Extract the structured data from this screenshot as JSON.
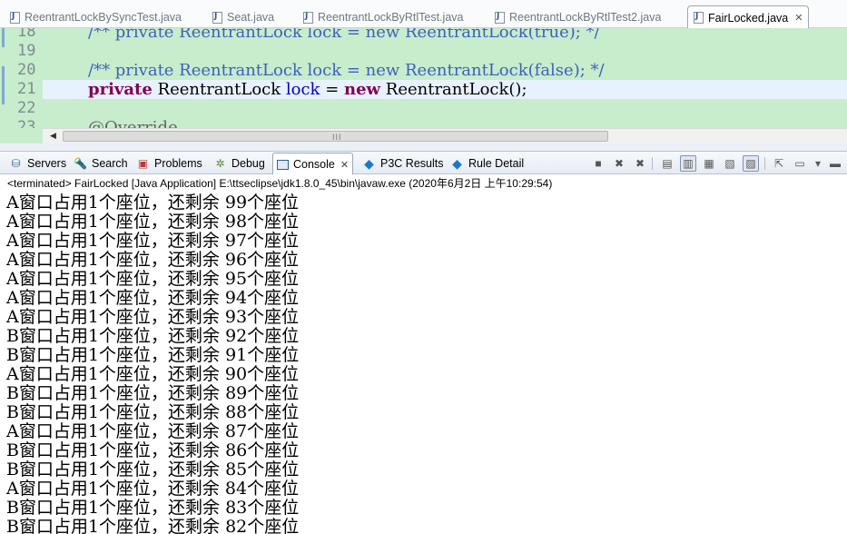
{
  "editor_tabs": [
    {
      "label": "ReentrantLockBySyncTest.java",
      "active": false
    },
    {
      "label": "Seat.java",
      "active": false
    },
    {
      "label": "ReentrantLockByRtlTest.java",
      "active": false
    },
    {
      "label": "ReentrantLockByRtlTest2.java",
      "active": false
    },
    {
      "label": "FairLocked.java",
      "active": true,
      "close": "✕"
    }
  ],
  "editor": {
    "line_numbers": [
      "18",
      "19",
      "20",
      "21",
      "22",
      "23"
    ],
    "lines": [
      {
        "comment": "/** private ReentrantLock lock = new ReentrantLock(true); */"
      },
      {},
      {
        "comment": "/** private ReentrantLock lock = new ReentrantLock(false); */"
      },
      {
        "kw1": "private",
        "type": " ReentrantLock ",
        "field": "lock",
        "eq": " = ",
        "kw2": "new",
        "rest": " ReentrantLock();"
      },
      {},
      {
        "annotation": "@Override"
      }
    ],
    "scroll_grip": "III"
  },
  "view_tabs": [
    {
      "label": "Servers",
      "icon": "servers-icon"
    },
    {
      "label": "Search",
      "icon": "search-icon"
    },
    {
      "label": "Problems",
      "icon": "problems-icon"
    },
    {
      "label": "Debug",
      "icon": "debug-icon"
    },
    {
      "label": "Console",
      "icon": "console-icon",
      "active": true,
      "close": "✕"
    },
    {
      "label": "P3C Results",
      "icon": "p3c-icon"
    },
    {
      "label": "Rule Detail",
      "icon": "p3c-icon"
    }
  ],
  "console": {
    "header": "<terminated> FairLocked [Java Application] E:\\ttseclipse\\jdk1.8.0_45\\bin\\javaw.exe (2020年6月2日 上午10:29:54)",
    "lines": [
      "A窗口占用1个座位，还剩余 99个座位",
      "A窗口占用1个座位，还剩余 98个座位",
      "A窗口占用1个座位，还剩余 97个座位",
      "A窗口占用1个座位，还剩余 96个座位",
      "A窗口占用1个座位，还剩余 95个座位",
      "A窗口占用1个座位，还剩余 94个座位",
      "A窗口占用1个座位，还剩余 93个座位",
      "B窗口占用1个座位，还剩余 92个座位",
      "B窗口占用1个座位，还剩余 91个座位",
      "A窗口占用1个座位，还剩余 90个座位",
      "B窗口占用1个座位，还剩余 89个座位",
      "B窗口占用1个座位，还剩余 88个座位",
      "A窗口占用1个座位，还剩余 87个座位",
      "B窗口占用1个座位，还剩余 86个座位",
      "B窗口占用1个座位，还剩余 85个座位",
      "A窗口占用1个座位，还剩余 84个座位",
      "B窗口占用1个座位，还剩余 83个座位",
      "B窗口占用1个座位，还剩余 82个座位"
    ]
  },
  "colors": {
    "editor_background": "#c7edcc",
    "current_line": "#e8f2fe",
    "keyword": "#7f0055",
    "comment": "#3f5fbf",
    "field": "#0000c0"
  }
}
